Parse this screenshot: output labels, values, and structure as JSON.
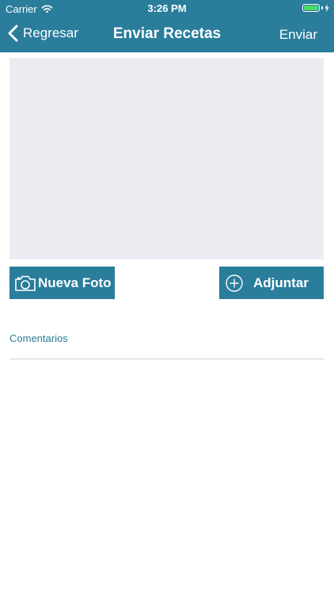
{
  "status": {
    "carrier": "Carrier",
    "time": "3:26 PM",
    "wifi_icon": "wifi-icon",
    "battery_icon": "battery-icon",
    "battery_color": "#4cd964"
  },
  "nav": {
    "back_label": "Regresar",
    "title": "Enviar Recetas",
    "send_label": "Enviar"
  },
  "actions": {
    "new_photo_label": "Nueva Foto",
    "new_photo_icon": "camera-icon",
    "attach_label": "Adjuntar",
    "attach_icon": "plus-circle-icon"
  },
  "comments": {
    "label": "Comentarios"
  },
  "colors": {
    "primary": "#2a7d9b",
    "placeholder": "#ebebf1"
  }
}
